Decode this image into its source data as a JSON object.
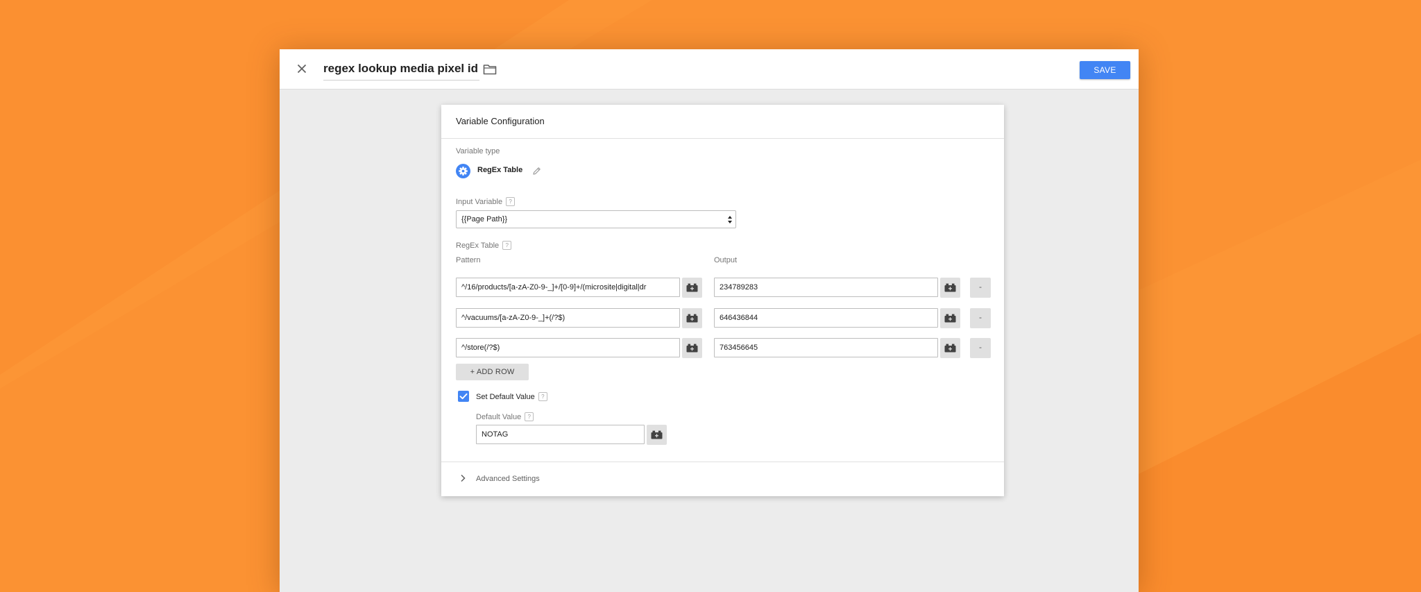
{
  "header": {
    "title": "regex lookup media pixel id",
    "save_label": "SAVE"
  },
  "card": {
    "title": "Variable Configuration",
    "variable_type_label": "Variable type",
    "variable_type_value": "RegEx Table",
    "input_variable_label": "Input Variable",
    "input_variable_value": "{{Page Path}}",
    "regex_table_label": "RegEx Table",
    "pattern_header": "Pattern",
    "output_header": "Output",
    "rows": [
      {
        "pattern": "^/16/products/[a-zA-Z0-9-_]+/[0-9]+/(microsite|digital|dr",
        "output": "234789283",
        "remove_label": "-"
      },
      {
        "pattern": "^/vacuums/[a-zA-Z0-9-_]+(/?$)",
        "output": "646436844",
        "remove_label": "-"
      },
      {
        "pattern": "^/store(/?$)",
        "output": "763456645",
        "remove_label": "-"
      }
    ],
    "add_row_label": "+ ADD ROW",
    "set_default_label": "Set Default Value",
    "set_default_checked": true,
    "default_value_label": "Default Value",
    "default_value": "NOTAG",
    "advanced_settings_label": "Advanced Settings",
    "help_glyph": "?"
  },
  "colors": {
    "background": "#fb9031",
    "accent": "#4285f4"
  },
  "icons": {
    "close": "close-icon",
    "folder": "folder-icon",
    "variable_type": "gear-icon",
    "edit": "pencil-icon",
    "insert_variable": "variable-brick-icon",
    "dropdown": "select-arrows-icon",
    "checkbox": "checkmark-icon",
    "expand": "chevron-right-icon"
  }
}
